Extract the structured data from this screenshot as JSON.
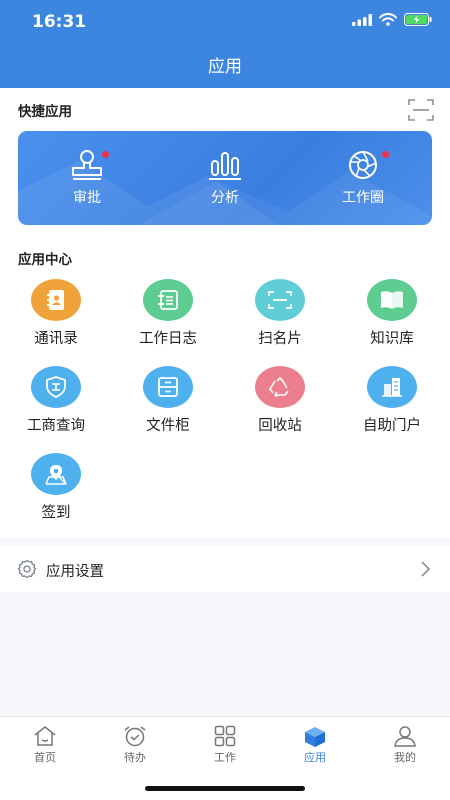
{
  "status_bar": {
    "time": "16:31"
  },
  "header": {
    "title": "应用"
  },
  "quick": {
    "section_title": "快捷应用",
    "items": [
      {
        "label": "审批",
        "icon": "stamp-icon",
        "badge": true
      },
      {
        "label": "分析",
        "icon": "bar-chart-icon",
        "badge": false
      },
      {
        "label": "工作圈",
        "icon": "camera-shutter-icon",
        "badge": true
      }
    ]
  },
  "app_center": {
    "section_title": "应用中心",
    "items": [
      {
        "label": "通讯录",
        "icon": "contacts-icon",
        "color": "#f0a33a"
      },
      {
        "label": "工作日志",
        "icon": "notebook-icon",
        "color": "#5ccc90"
      },
      {
        "label": "扫名片",
        "icon": "scan-card-icon",
        "color": "#5fcdd6"
      },
      {
        "label": "知识库",
        "icon": "book-icon",
        "color": "#5ccc90"
      },
      {
        "label": "工商查询",
        "icon": "shield-icon",
        "color": "#4fb0ee"
      },
      {
        "label": "文件柜",
        "icon": "cabinet-icon",
        "color": "#4fb0ee"
      },
      {
        "label": "回收站",
        "icon": "recycle-icon",
        "color": "#eb7f8e"
      },
      {
        "label": "自助门户",
        "icon": "building-icon",
        "color": "#4fb0ee"
      },
      {
        "label": "签到",
        "icon": "location-pin-icon",
        "color": "#4fb0ee"
      }
    ]
  },
  "settings": {
    "label": "应用设置"
  },
  "tabbar": {
    "tabs": [
      {
        "label": "首页",
        "icon": "home-icon",
        "active": false
      },
      {
        "label": "待办",
        "icon": "alarm-clock-icon",
        "active": false
      },
      {
        "label": "工作",
        "icon": "grid-icon",
        "active": false
      },
      {
        "label": "应用",
        "icon": "cube-icon",
        "active": true
      },
      {
        "label": "我的",
        "icon": "person-icon",
        "active": false
      }
    ]
  },
  "colors": {
    "primary": "#3d86e0",
    "badge": "#f0314a"
  }
}
